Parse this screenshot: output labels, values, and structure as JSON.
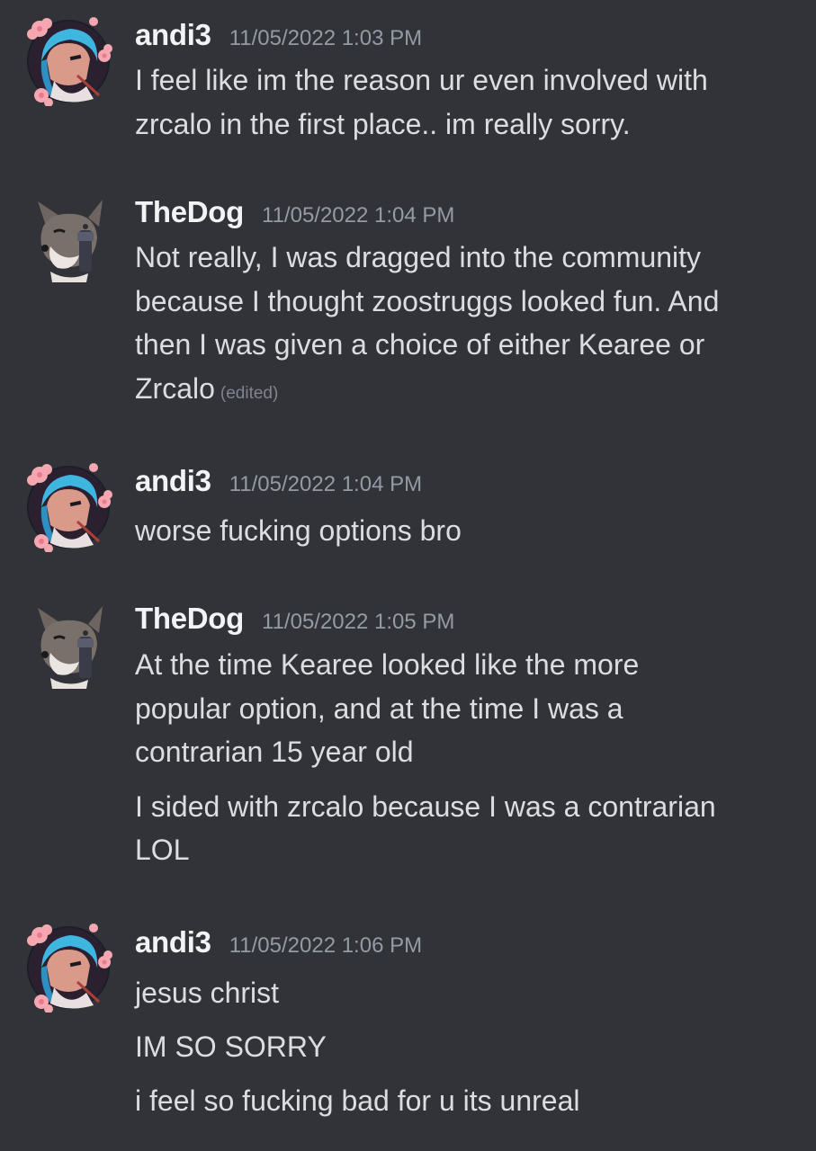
{
  "messages": [
    {
      "author": "andi3",
      "timestamp": "11/05/2022 1:03 PM",
      "avatar": "anime-girl-avatar",
      "lines": [
        "I feel like im the reason ur even involved with",
        "zrcalo in the first place.. im really sorry."
      ]
    },
    {
      "author": "TheDog",
      "timestamp": "11/05/2022 1:04 PM",
      "avatar": "wolf-with-gun-avatar",
      "lines": [
        "Not really, I was dragged into the community",
        "because I thought zoostruggs looked fun. And",
        "then I was given a choice of either Kearee or",
        "Zrcalo"
      ],
      "edited": "(edited)"
    },
    {
      "author": "andi3",
      "timestamp": "11/05/2022 1:04 PM",
      "avatar": "anime-girl-avatar",
      "lines": [
        "worse fucking options bro"
      ]
    },
    {
      "author": "TheDog",
      "timestamp": "11/05/2022 1:05 PM",
      "avatar": "wolf-with-gun-avatar",
      "lines": [
        "At the time Kearee looked like the more",
        "popular option, and at the time I was a",
        "contrarian 15 year old",
        "I sided with zrcalo because I was a contrarian",
        "LOL"
      ]
    },
    {
      "author": "andi3",
      "timestamp": "11/05/2022 1:06 PM",
      "avatar": "anime-girl-avatar",
      "lines": [
        "jesus christ",
        "IM SO SORRY",
        "i feel so fucking bad for u its unreal"
      ]
    }
  ],
  "colors": {
    "background": "#313338",
    "username": "#f2f3f5",
    "timestamp": "#949ba4",
    "text": "#dbdee1",
    "edited": "#80848e",
    "flower": "#f4a7b0",
    "hair": "#3fb6e0"
  }
}
